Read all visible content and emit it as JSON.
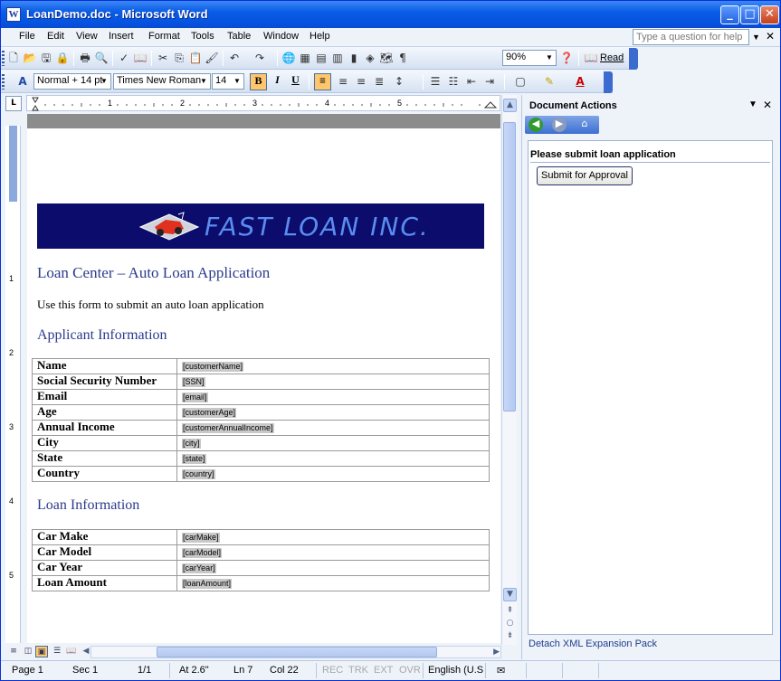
{
  "window": {
    "title": "LoanDemo.doc - Microsoft Word"
  },
  "menu": {
    "items": [
      "File",
      "Edit",
      "View",
      "Insert",
      "Format",
      "Tools",
      "Table",
      "Window",
      "Help"
    ],
    "help_placeholder": "Type a question for help"
  },
  "toolbar": {
    "zoom": "90%",
    "read_label": "Read"
  },
  "format": {
    "style": "Normal + 14 pt",
    "font": "Times New Roman",
    "size": "14",
    "bold": "B",
    "italic": "I",
    "underline": "U"
  },
  "ruler": {
    "unit_marker": "L",
    "labels": [
      "1",
      "2",
      "3",
      "4",
      "5"
    ],
    "vlabels": [
      "1",
      "2",
      "3",
      "4",
      "5"
    ]
  },
  "task_pane": {
    "title": "Document Actions",
    "pane_heading": "Please submit loan application",
    "submit_button": "Submit for Approval",
    "footer_link": "Detach XML Expansion Pack"
  },
  "document": {
    "banner_text": "FAST LOAN INC.",
    "heading": "Loan Center – Auto Loan Application",
    "intro": "Use this form to submit an auto loan application",
    "applicant_heading": "Applicant Information",
    "applicant_rows": [
      {
        "label": "Name",
        "tag": "[customerName]"
      },
      {
        "label": "Social Security Number",
        "tag": "[SSN]"
      },
      {
        "label": "Email",
        "tag": "[email]"
      },
      {
        "label": "Age",
        "tag": "[customerAge]"
      },
      {
        "label": "Annual Income",
        "tag": "[customerAnnualIncome]"
      },
      {
        "label": "City",
        "tag": "[city]"
      },
      {
        "label": "State",
        "tag": "[state]"
      },
      {
        "label": "Country",
        "tag": "[country]"
      }
    ],
    "loan_heading": "Loan Information",
    "loan_rows": [
      {
        "label": "Car Make",
        "tag": "[carMake]"
      },
      {
        "label": "Car Model",
        "tag": "[carModel]"
      },
      {
        "label": "Car Year",
        "tag": "[carYear]"
      },
      {
        "label": "Loan Amount",
        "tag": "[loanAmount]"
      }
    ]
  },
  "status": {
    "page": "Page 1",
    "sec": "Sec 1",
    "pages": "1/1",
    "at": "At 2.6\"",
    "ln": "Ln 7",
    "col": "Col 22",
    "rec": "REC",
    "trk": "TRK",
    "ext": "EXT",
    "ovr": "OVR",
    "lang": "English (U.S"
  }
}
